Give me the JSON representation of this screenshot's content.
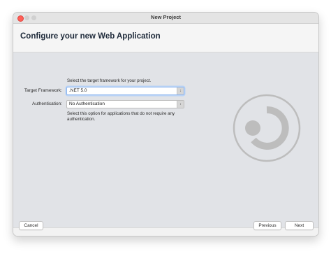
{
  "window": {
    "title": "New Project"
  },
  "header": {
    "title": "Configure your new Web Application"
  },
  "form": {
    "framework_hint": "Select the target framework for your project.",
    "framework_label": "Target Framework:",
    "framework_value": ".NET 5.0",
    "auth_label": "Authentication:",
    "auth_value": "No Authentication",
    "auth_hint": "Select this option for applications that do not require any authentication."
  },
  "footer": {
    "cancel_label": "Cancel",
    "previous_label": "Previous",
    "next_label": "Next"
  },
  "icons": {
    "close": "close-dot",
    "minimize": "minimize-dot",
    "maximize": "maximize-dot",
    "dropdown": "chevron-updown-icon",
    "logo": "web-app-logo-icon"
  },
  "colors": {
    "close_dot": "#ff5f57",
    "focus_ring": "#8fb6ee",
    "logo_gray": "#bdbdbd"
  }
}
